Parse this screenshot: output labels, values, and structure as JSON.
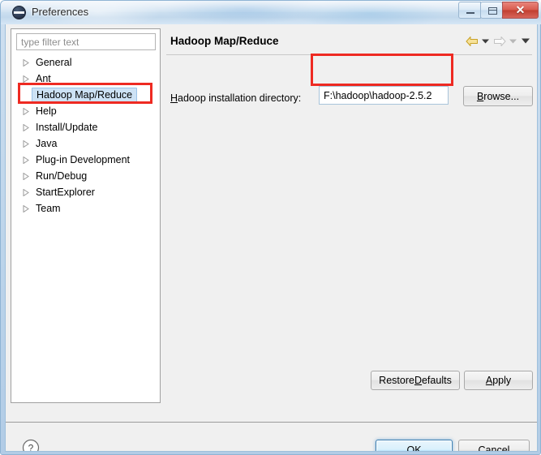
{
  "window": {
    "title": "Preferences",
    "icon": "eclipse-icon",
    "controls": {
      "minimize": "minimize-icon",
      "restore": "restore-icon",
      "close": "✕"
    }
  },
  "sidebar": {
    "filter": {
      "placeholder": "type filter text",
      "value": ""
    },
    "items": [
      {
        "label": "General",
        "expandable": true,
        "selected": false
      },
      {
        "label": "Ant",
        "expandable": true,
        "selected": false
      },
      {
        "label": "Hadoop Map/Reduce",
        "expandable": false,
        "selected": true
      },
      {
        "label": "Help",
        "expandable": true,
        "selected": false
      },
      {
        "label": "Install/Update",
        "expandable": true,
        "selected": false
      },
      {
        "label": "Java",
        "expandable": true,
        "selected": false
      },
      {
        "label": "Plug-in Development",
        "expandable": true,
        "selected": false
      },
      {
        "label": "Run/Debug",
        "expandable": true,
        "selected": false
      },
      {
        "label": "StartExplorer",
        "expandable": true,
        "selected": false
      },
      {
        "label": "Team",
        "expandable": true,
        "selected": false
      }
    ]
  },
  "content": {
    "title": "Hadoop Map/Reduce",
    "nav": {
      "back": "back-arrow-icon",
      "back_menu": "chevron-down-icon",
      "forward": "forward-arrow-icon",
      "forward_menu": "chevron-down-icon",
      "view_menu": "chevron-down-icon"
    },
    "field": {
      "label_prefix": "H",
      "label_rest": "adoop installation directory:",
      "value": "F:\\hadoop\\hadoop-2.5.2",
      "placeholder": ""
    },
    "browse_button": {
      "prefix": "B",
      "rest": "rowse..."
    },
    "restore_defaults_button": {
      "before": "Restore ",
      "key": "D",
      "after": "efaults"
    },
    "apply_button": {
      "key": "A",
      "after": "pply"
    }
  },
  "footer": {
    "help": "help-icon",
    "ok_label": "OK",
    "cancel_label": "Cancel"
  },
  "annotations": {
    "colors": {
      "highlight": "#ee2a22",
      "selection": "#cde2f5",
      "accent": "#3c7fb1"
    }
  }
}
